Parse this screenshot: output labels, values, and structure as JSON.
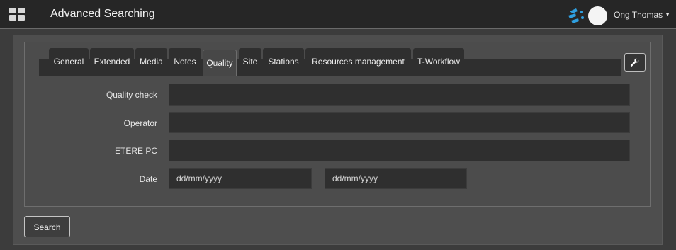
{
  "header": {
    "title": "Advanced Searching",
    "user_name": "Ong Thomas",
    "menu_icon": "grid-icon",
    "brand_icon": "etere-logo-icon"
  },
  "tabs": [
    {
      "label": "General",
      "active": false
    },
    {
      "label": "Extended",
      "active": false
    },
    {
      "label": "Media",
      "active": false
    },
    {
      "label": "Notes",
      "active": false
    },
    {
      "label": "Quality",
      "active": true
    },
    {
      "label": "Site",
      "active": false
    },
    {
      "label": "Stations",
      "active": false
    },
    {
      "label": "Resources management",
      "active": false
    },
    {
      "label": "T-Workflow",
      "active": false
    }
  ],
  "form": {
    "quality_check": {
      "label": "Quality check",
      "value": ""
    },
    "operator": {
      "label": "Operator",
      "value": ""
    },
    "etere_pc": {
      "label": "ETERE PC",
      "value": ""
    },
    "date": {
      "label": "Date",
      "from_placeholder": "dd/mm/yyyy",
      "to_placeholder": "dd/mm/yyyy"
    }
  },
  "actions": {
    "search_label": "Search",
    "settings_icon": "wrench-icon"
  },
  "colors": {
    "background": "#3c3c3c",
    "topbar": "#262626",
    "field": "#2f2f2f",
    "brand_blue": "#2f9fe0"
  }
}
